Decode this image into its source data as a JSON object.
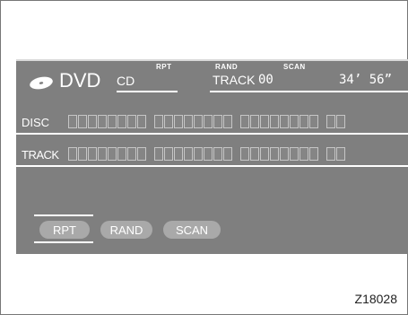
{
  "display": {
    "mode_label": "DVD",
    "disc_type": "CD",
    "status_flags": [
      "RPT",
      "RAND",
      "SCAN"
    ],
    "track_label": "TRACK",
    "track_number": "00",
    "time": "34’ 56”",
    "rows": [
      {
        "label": "DISC",
        "groups": [
          8,
          8,
          8,
          2
        ]
      },
      {
        "label": "TRACK",
        "groups": [
          8,
          8,
          8,
          2
        ]
      }
    ]
  },
  "buttons": {
    "rpt": "RPT",
    "rand": "RAND",
    "scan": "SCAN",
    "active": "rpt"
  },
  "figure_code": "Z18028",
  "colors": {
    "screen_bg": "#7f7f7f",
    "text": "#ffffff",
    "button_bg": "#a9a9a9"
  },
  "icons": {
    "disc": "disc-icon"
  }
}
